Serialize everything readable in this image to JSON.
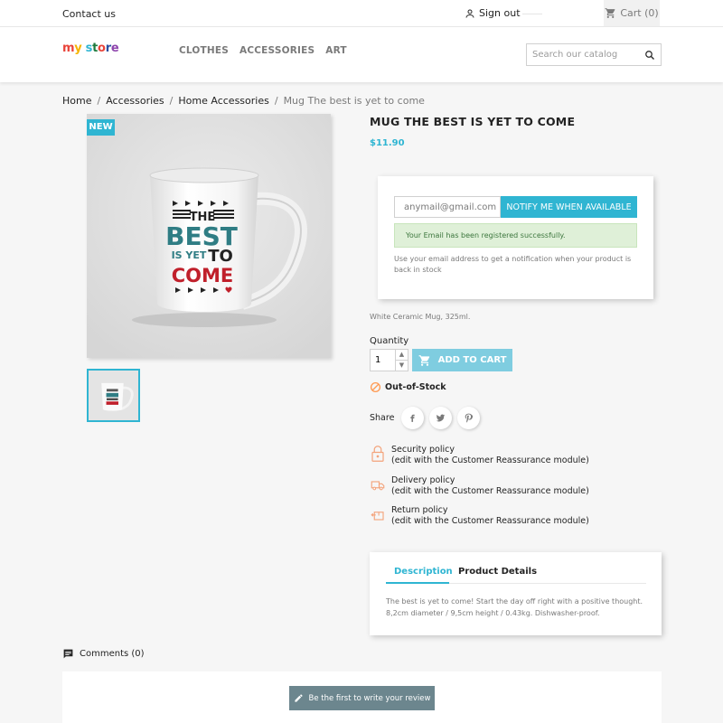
{
  "topbar": {
    "contact": "Contact us",
    "signin": "Sign out",
    "cart": "Cart (0)"
  },
  "header": {
    "logo_parts": [
      "m",
      "y",
      " ",
      "s",
      "t",
      "o",
      "r",
      "e"
    ],
    "logo_colors": [
      "#e9443a",
      "#f6b400",
      "#ffffff",
      "#2fb5d2",
      "#1e7a3d",
      "#e9443a",
      "#2b4fa0",
      "#8e44ad"
    ],
    "nav": [
      "CLOTHES",
      "ACCESSORIES",
      "ART"
    ],
    "search_placeholder": "Search our catalog"
  },
  "breadcrumb": [
    "Home",
    "Accessories",
    "Home Accessories",
    "Mug The best is yet to come"
  ],
  "product": {
    "badge": "NEW",
    "title": "MUG THE BEST IS YET TO COME",
    "price": "$11.90",
    "mug_text": {
      "the": "THE",
      "best": "BEST",
      "is_yet": "IS YET",
      "to": "TO",
      "come": "COME"
    },
    "short_description": "White Ceramic Mug, 325ml.",
    "quantity_label": "Quantity",
    "quantity_value": "1",
    "add_to_cart": "ADD TO CART",
    "stock_status": "Out-of-Stock"
  },
  "notify": {
    "email_value": "anymail@gmail.com",
    "button": "NOTIFY ME WHEN AVAILABLE",
    "success": "Your Email has been registered successfully.",
    "hint": "Use your email address to get a notification when your product is back in stock"
  },
  "share": {
    "label": "Share"
  },
  "reassurance": [
    {
      "title": "Security policy",
      "sub": "(edit with the Customer Reassurance module)"
    },
    {
      "title": "Delivery policy",
      "sub": "(edit with the Customer Reassurance module)"
    },
    {
      "title": "Return policy",
      "sub": "(edit with the Customer Reassurance module)"
    }
  ],
  "tabs": {
    "active": "Description",
    "other": "Product Details",
    "content": "The best is yet to come! Start the day off right with a positive thought. 8,2cm diameter / 9,5cm height / 0.43kg. Dishwasher-proof."
  },
  "comments": {
    "label": "Comments (0)",
    "button": "Be the first to write your review"
  },
  "colors": {
    "accent": "#2fb5d2",
    "accent_light": "#7fcde0",
    "success_bg": "#dff0d8",
    "review_btn": "#6c868e",
    "mug_red": "#c0202b",
    "mug_teal": "#2f7d84"
  }
}
